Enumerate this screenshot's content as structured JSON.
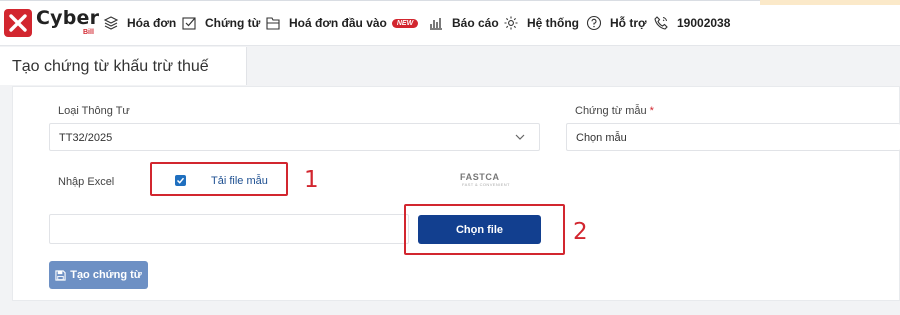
{
  "brand": {
    "name": "Cyber",
    "sub": "Bill"
  },
  "nav": {
    "invoice": "Hóa đơn",
    "voucher": "Chứng từ",
    "input_invoice": "Hoá đơn đầu vào",
    "new_badge": "NEW",
    "report": "Báo cáo",
    "system": "Hệ thống",
    "support": "Hỗ trợ",
    "hotline": "19002038"
  },
  "page": {
    "title": "Tạo chứng từ khấu trừ thuế"
  },
  "form": {
    "circular_label": "Loại Thông Tư",
    "circular_value": "TT32/2025",
    "template_label": "Chứng từ mẫu",
    "required_mark": "*",
    "template_placeholder": "Chọn mẫu",
    "import_excel_label": "Nhập Excel",
    "download_template": "Tải file mẫu",
    "choose_file": "Chọn file",
    "create_button": "Tạo chứng từ",
    "checkbox_checked": true
  },
  "partner_logo": {
    "name": "FASTCA",
    "tagline": "FAST & CONVENIENT"
  },
  "annotations": {
    "first": "1",
    "second": "2"
  },
  "colors": {
    "brand_red": "#d2262f",
    "primary": "#123f8f",
    "create_button": "#6d90c4"
  }
}
